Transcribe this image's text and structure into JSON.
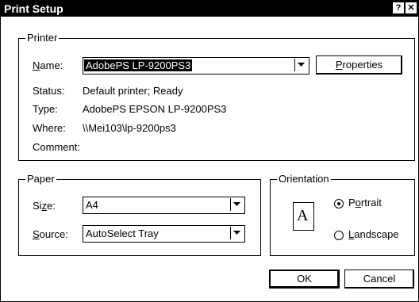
{
  "window": {
    "title": "Print Setup",
    "help_btn": "?",
    "close_btn": "✕"
  },
  "printer": {
    "legend": "Printer",
    "name_label_u": "N",
    "name_label_rest": "ame:",
    "name_value": "AdobePS LP-9200PS3",
    "properties_u": "P",
    "properties_rest": "roperties",
    "status_label": "Status:",
    "status_value": "Default printer; Ready",
    "type_label": "Type:",
    "type_value": "AdobePS EPSON LP-9200PS3",
    "where_label": "Where:",
    "where_value": "\\\\Mei103\\lp-9200ps3",
    "comment_label": "Comment:",
    "comment_value": ""
  },
  "paper": {
    "legend": "Paper",
    "size_label_pre": "Si",
    "size_label_u": "z",
    "size_label_post": "e:",
    "size_value": "A4",
    "source_label_u": "S",
    "source_label_rest": "ource:",
    "source_value": "AutoSelect Tray"
  },
  "orientation": {
    "legend": "Orientation",
    "icon_letter": "A",
    "portrait_pre": "P",
    "portrait_u": "o",
    "portrait_post": "rtrait",
    "landscape_u": "L",
    "landscape_rest": "andscape",
    "selected": "portrait"
  },
  "buttons": {
    "ok": "OK",
    "cancel": "Cancel"
  }
}
